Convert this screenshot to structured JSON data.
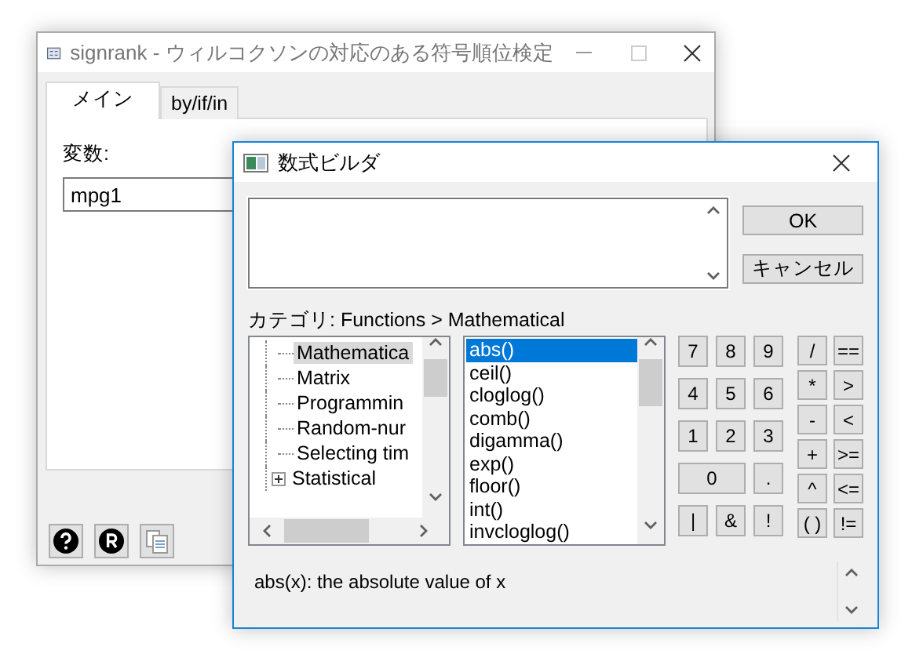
{
  "main_window": {
    "title": "signrank - ウィルコクソンの対応のある符号順位検定",
    "tabs": [
      {
        "label": "メイン",
        "selected": true
      },
      {
        "label": "by/if/in",
        "selected": false
      }
    ],
    "variable_label": "変数:",
    "variable_value": "mpg1"
  },
  "dialog": {
    "title": "数式ビルダ",
    "buttons": [
      "OK",
      "キャンセル"
    ],
    "category_label": "カテゴリ: Functions > Mathematical",
    "tree": [
      {
        "label": "Mathematica",
        "selected": true,
        "collapsed": false
      },
      {
        "label": "Matrix",
        "selected": false,
        "collapsed": false
      },
      {
        "label": "Programmin",
        "selected": false,
        "collapsed": false
      },
      {
        "label": "Random-nur",
        "selected": false,
        "collapsed": false
      },
      {
        "label": "Selecting tim",
        "selected": false,
        "collapsed": false
      },
      {
        "label": "Statistical",
        "selected": false,
        "collapsed": true
      }
    ],
    "functions": [
      {
        "label": "abs()",
        "selected": true
      },
      {
        "label": "ceil()",
        "selected": false
      },
      {
        "label": "cloglog()",
        "selected": false
      },
      {
        "label": "comb()",
        "selected": false
      },
      {
        "label": "digamma()",
        "selected": false
      },
      {
        "label": "exp()",
        "selected": false
      },
      {
        "label": "floor()",
        "selected": false
      },
      {
        "label": "int()",
        "selected": false
      },
      {
        "label": "invcloglog()",
        "selected": false
      }
    ],
    "number_keys": [
      {
        "label": "7",
        "kind": "single"
      },
      {
        "label": "8",
        "kind": "single"
      },
      {
        "label": "9",
        "kind": "single"
      },
      {
        "label": "4",
        "kind": "single"
      },
      {
        "label": "5",
        "kind": "single"
      },
      {
        "label": "6",
        "kind": "single"
      },
      {
        "label": "1",
        "kind": "single"
      },
      {
        "label": "2",
        "kind": "single"
      },
      {
        "label": "3",
        "kind": "single"
      },
      {
        "label": "0",
        "kind": "wide"
      },
      {
        "label": ".",
        "kind": "single"
      },
      {
        "label": "|",
        "kind": "single"
      },
      {
        "label": "&",
        "kind": "single"
      },
      {
        "label": "!",
        "kind": "single"
      }
    ],
    "operator_keys": [
      "/",
      "==",
      "*",
      ">",
      "-",
      "<",
      "+",
      ">=",
      "^",
      "<=",
      "( )",
      "!="
    ],
    "description": "abs(x):  the absolute value of x"
  }
}
